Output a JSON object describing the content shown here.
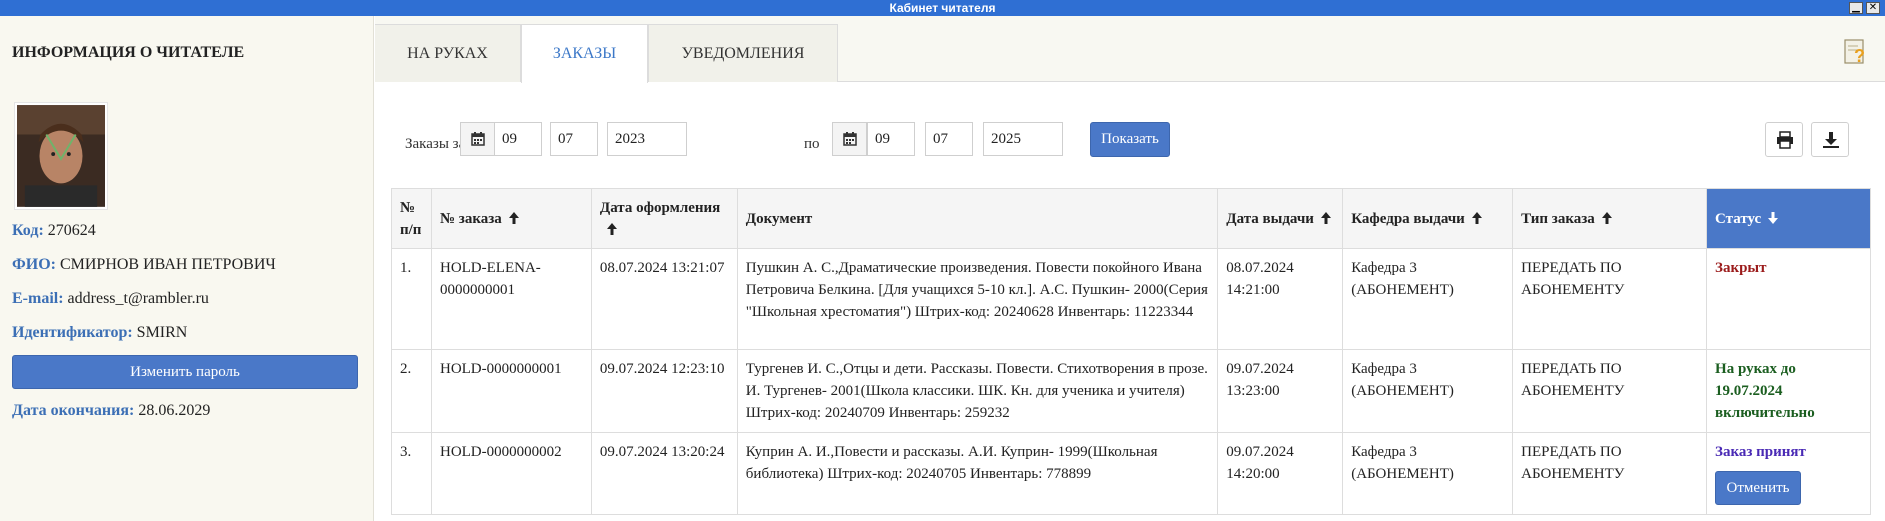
{
  "window": {
    "title": "Кабинет читателя",
    "min_glyph": "▁",
    "close_glyph": "✕"
  },
  "reader": {
    "heading": "ИНФОРМАЦИЯ О ЧИТАТЕЛЕ",
    "code_label": "Код:",
    "code": "270624",
    "name_label": "ФИО:",
    "name": "СМИРНОВ ИВАН ПЕТРОВИЧ",
    "email_label": "E-mail:",
    "email": "address_t@rambler.ru",
    "id_label": "Идентификатор:",
    "id": "SMIRN",
    "change_password": "Изменить пароль",
    "end_label": "Дата окончания:",
    "end_date": "28.06.2029"
  },
  "tabs": [
    {
      "label": "НА РУКАХ",
      "active": false
    },
    {
      "label": "ЗАКАЗЫ",
      "active": true
    },
    {
      "label": "УВЕДОМЛЕНИЯ",
      "active": false
    }
  ],
  "filter": {
    "label": "Заказы  за период  с",
    "to_label": "по",
    "from": {
      "day": "09",
      "month": "07",
      "year": "2023"
    },
    "to": {
      "day": "09",
      "month": "07",
      "year": "2025"
    },
    "show_button": "Показать"
  },
  "icons": {
    "help": "help-icon",
    "print": "print-icon",
    "download": "download-icon",
    "calendar": "calendar-icon",
    "accent": "#4a78c8"
  },
  "table": {
    "headers": [
      "№ п/п",
      "№ заказа",
      "Дата оформления",
      "Документ",
      "Дата выдачи",
      "Кафедра выдачи",
      "Тип заказа",
      "Статус"
    ],
    "rows": [
      {
        "num": "1.",
        "order": "HOLD-ELENA-0000000001",
        "created": "08.07.2024 13:21:07",
        "document": "Пушкин А. С.,Драматические произведения. Повести покойного Ивана Петровича Белкина. [Для учащихся 5-10 кл.]. А.С. Пушкин- 2000(Серия \"Школьная хрестоматия\") Штрих-код: 20240628 Инвентарь: 11223344",
        "issued": "08.07.2024 14:21:00",
        "dept": "Кафедра 3 (АБОНЕМЕНТ)",
        "type": "ПЕРЕДАТЬ ПО АБОНЕМЕНТУ",
        "status": "Закрыт"
      },
      {
        "num": "2.",
        "order": "HOLD-0000000001",
        "created": "09.07.2024 12:23:10",
        "document": "Тургенев И. С.,Отцы и дети. Рассказы. Повести. Стихотворения в прозе. И. Тургенев- 2001(Школа классики. ШК. Кн. для ученика и учителя) Штрих-код: 20240709 Инвентарь: 259232",
        "issued": "09.07.2024 13:23:00",
        "dept": "Кафедра 3 (АБОНЕМЕНТ)",
        "type": "ПЕРЕДАТЬ ПО АБОНЕМЕНТУ",
        "status": "На руках до 19.07.2024 включительно"
      },
      {
        "num": "3.",
        "order": "HOLD-0000000002",
        "created": "09.07.2024 13:20:24",
        "document": "Куприн А. И.,Повести и рассказы. А.И. Куприн- 1999(Школьная библиотека) Штрих-код: 20240705 Инвентарь: 778899",
        "issued": "09.07.2024 14:20:00",
        "dept": "Кафедра 3 (АБОНЕМЕНТ)",
        "type": "ПЕРЕДАТЬ ПО АБОНЕМЕНТУ",
        "status": "Заказ принят",
        "action": "Отменить"
      }
    ]
  }
}
